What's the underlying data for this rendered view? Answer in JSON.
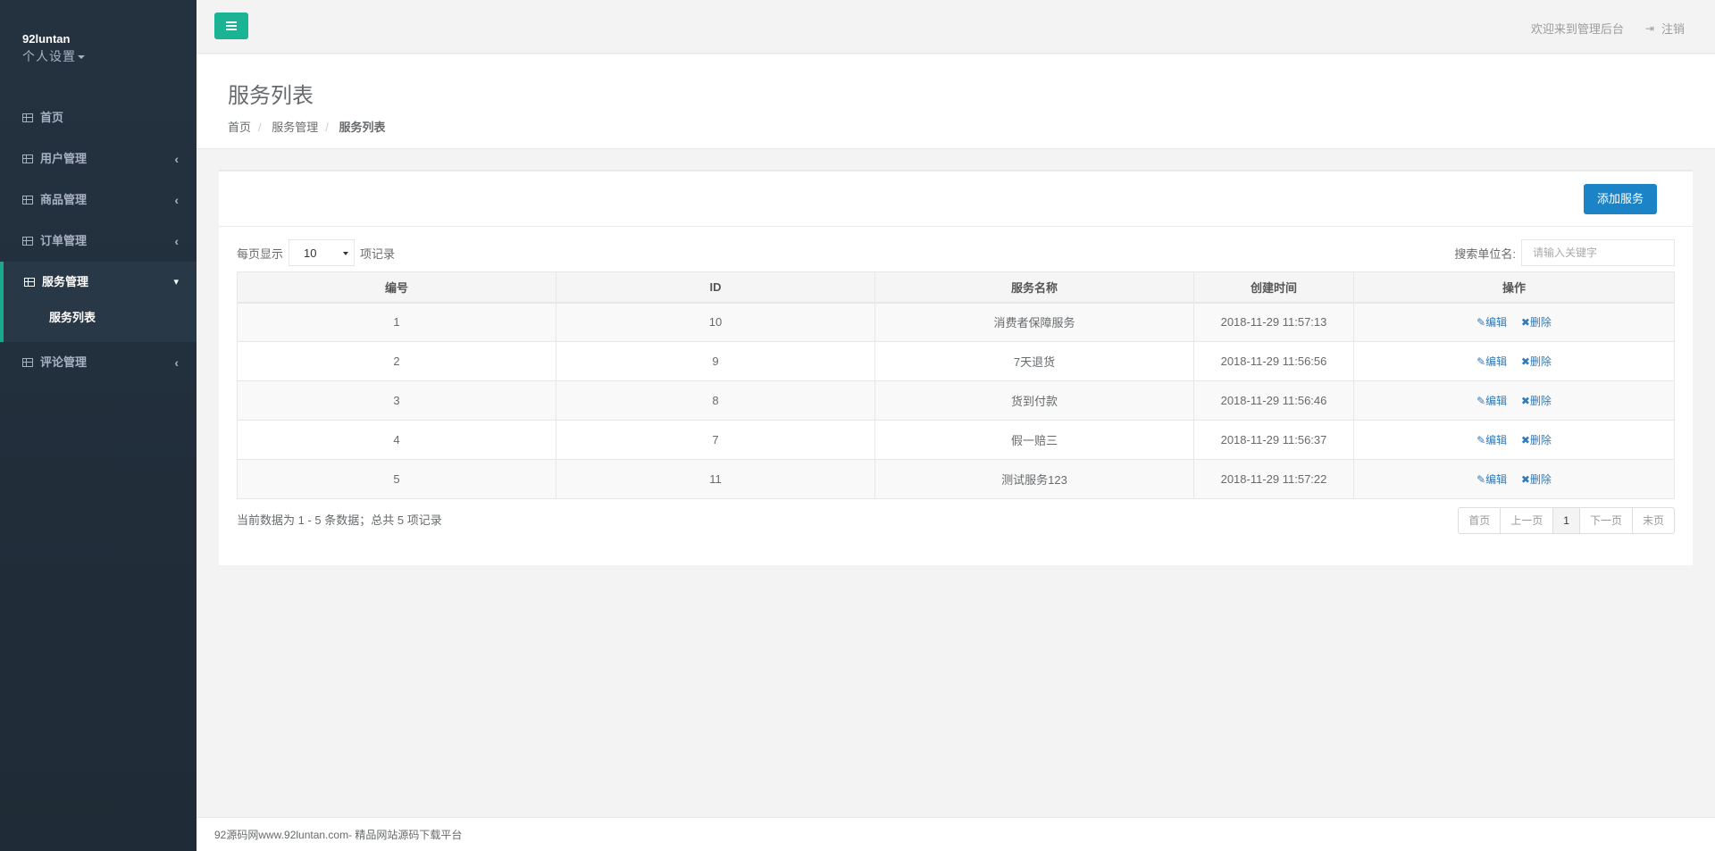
{
  "sidebar": {
    "username": "92luntan",
    "settings_label": "个人设置",
    "items": [
      {
        "label": "首页"
      },
      {
        "label": "用户管理"
      },
      {
        "label": "商品管理"
      },
      {
        "label": "订单管理"
      },
      {
        "label": "服务管理"
      },
      {
        "label": "评论管理"
      }
    ],
    "sub_items": [
      {
        "label": "服务列表"
      }
    ]
  },
  "topbar": {
    "welcome": "欢迎来到管理后台",
    "logout_label": "注销"
  },
  "page": {
    "title": "服务列表",
    "breadcrumb": [
      "首页",
      "服务管理",
      "服务列表"
    ]
  },
  "toolbar": {
    "add_label": "添加服务",
    "length_prefix": "每页显示",
    "length_value": "10",
    "length_suffix": "项记录",
    "search_label": "搜索单位名:",
    "search_placeholder": "请输入关键字"
  },
  "table": {
    "columns": [
      "编号",
      "ID",
      "服务名称",
      "创建时间",
      "操作"
    ],
    "rows": [
      {
        "no": "1",
        "id": "10",
        "name": "消费者保障服务",
        "time": "2018-11-29 11:57:13"
      },
      {
        "no": "2",
        "id": "9",
        "name": "7天退货",
        "time": "2018-11-29 11:56:56"
      },
      {
        "no": "3",
        "id": "8",
        "name": "货到付款",
        "time": "2018-11-29 11:56:46"
      },
      {
        "no": "4",
        "id": "7",
        "name": "假一赔三",
        "time": "2018-11-29 11:56:37"
      },
      {
        "no": "5",
        "id": "11",
        "name": "测试服务123",
        "time": "2018-11-29 11:57:22"
      }
    ],
    "edit_label": "编辑",
    "delete_label": "删除"
  },
  "footer_info": "当前数据为 1 - 5 条数据；总共 5 项记录",
  "pagination": {
    "first": "首页",
    "prev": "上一页",
    "current": "1",
    "next": "下一页",
    "last": "末页"
  },
  "footer": "92源码网www.92luntan.com- 精品网站源码下载平台",
  "colors": {
    "sidebar_bg": "#2f4050",
    "accent_green": "#1ab394",
    "primary_blue": "#1c84c6"
  }
}
